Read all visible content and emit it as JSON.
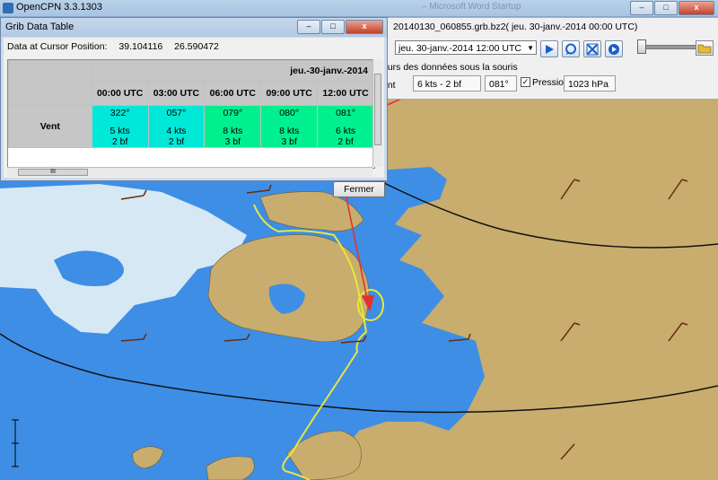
{
  "app": {
    "title": "OpenCPN 3.3.1303"
  },
  "background_titles": {
    "text": "– Microsoft Word Startup"
  },
  "grib": {
    "file": "20140130_060855.grb.bz2( jeu. 30-janv.-2014 00:00  UTC)",
    "time_selected": "jeu. 30-janv.-2014 12:00  UTC",
    "cursor_heading": "eurs des données sous la souris",
    "vent_label": "ent",
    "wind_value": "6 kts -  2 bf",
    "wind_dir": "081°",
    "pression_label": "Pression",
    "pression_checked": "✓",
    "pression_value": "1023 hPa"
  },
  "dialog": {
    "title": "Grib Data Table",
    "cursor_label": "Data at Cursor Position:",
    "lat": "39.104116",
    "lon": "26.590472",
    "date": "jeu.-30-janv.-2014",
    "times": [
      "00:00  UTC",
      "03:00  UTC",
      "06:00  UTC",
      "09:00  UTC",
      "12:00  UTC"
    ],
    "row_label": "Vent",
    "cells": [
      {
        "dir": "322°",
        "kts": "5 kts",
        "bf": "2 bf",
        "color": "#00e8d8"
      },
      {
        "dir": "057°",
        "kts": "4 kts",
        "bf": "2 bf",
        "color": "#00e8d8"
      },
      {
        "dir": "079°",
        "kts": "8 kts",
        "bf": "3 bf",
        "color": "#00f090"
      },
      {
        "dir": "080°",
        "kts": "8 kts",
        "bf": "3 bf",
        "color": "#00f090"
      },
      {
        "dir": "081°",
        "kts": "6 kts",
        "bf": "2 bf",
        "color": "#00f090"
      }
    ],
    "hscroll_glyph": "III",
    "close_label": "Fermer"
  },
  "colors": {
    "land": "#c8ad6e",
    "deep_water": "#3e8ee6",
    "shallow_water": "#d6e8f3",
    "track": "#e7e83a",
    "arrow_annot": "#e53030"
  }
}
